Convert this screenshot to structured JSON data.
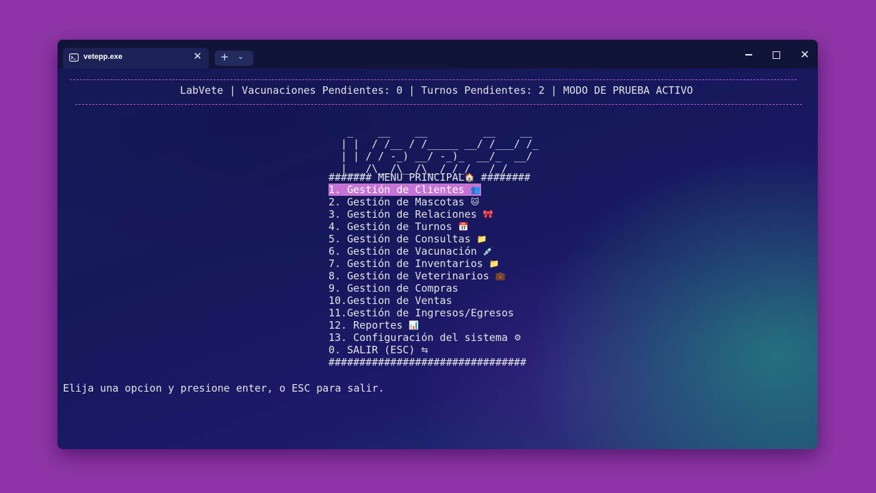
{
  "tab": {
    "title": "vetepp.exe",
    "icon": "terminal-icon",
    "close_label": "✕"
  },
  "new_tab": {
    "plus_label": "+",
    "dropdown_label": "⌄"
  },
  "window_controls": {
    "close_label": "✕"
  },
  "status_line": "LabVete | Vacunaciones Pendientes: 0 | Turnos Pendientes: 2 | MODO DE PRUEBA ACTIVO",
  "ascii_art": [
    " _    __    __         __    __ ",
    "| |  / /__ / /_____ __/ /___/ /_",
    "| | / / -_) __/ -_)_  __/_  __/",
    "|___/\\__/\\__/\\__/ /_/   /_/   "
  ],
  "menu": {
    "header": "####### MENU PRINCIPAL",
    "header_tail": " ########",
    "header_emoji": "🏠",
    "items": [
      {
        "label": "1. Gestión de Clientes ",
        "emoji": "👥",
        "selected": true
      },
      {
        "label": "2. Gestión de Mascotas ",
        "emoji": "🐱"
      },
      {
        "label": "3. Gestión de Relaciones ",
        "emoji": "🎀"
      },
      {
        "label": "4. Gestión de Turnos ",
        "emoji": "📅"
      },
      {
        "label": "5. Gestión de Consultas ",
        "emoji": "📁"
      },
      {
        "label": "6. Gestión de Vacunación ",
        "emoji": "💉"
      },
      {
        "label": "7. Gestión de Inventarios ",
        "emoji": "📁"
      },
      {
        "label": "8. Gestión de Veterinarios ",
        "emoji": "💼"
      },
      {
        "label": "9. Gestion de Compras",
        "emoji": ""
      },
      {
        "label": "10.Gestion de Ventas",
        "emoji": ""
      },
      {
        "label": "11.Gestión de Ingresos/Egresos",
        "emoji": ""
      },
      {
        "label": "12. Reportes ",
        "emoji": "📊"
      },
      {
        "label": "13. Configuración del sistema ",
        "emoji": "⚙"
      },
      {
        "label": "0. SALIR (ESC) ",
        "emoji": "⇆"
      }
    ],
    "footer": "################################"
  },
  "prompt": "Elija una opcion y presione enter, o ESC para salir.",
  "colors": {
    "highlight": "#c574d6",
    "separator": "#c25ad6",
    "text": "#e4e4ea"
  }
}
